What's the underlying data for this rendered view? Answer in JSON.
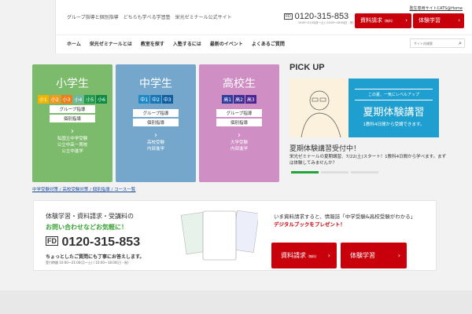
{
  "header": {
    "tagline": "グループ指導と個別指導　どちらも学べる学習塾　栄光ゼミナール公式サイト",
    "phone_icon": "フリーダイヤル",
    "phone": "0120-315-853",
    "phone_hours": "10:00～21:00(月～土) / 10:00～18:00(日・祝)",
    "cats_link": "塾生専用サイトCATS@Home",
    "request_btn": "資料請求",
    "request_small": "（無料）",
    "trial_btn": "体験学習",
    "arrow": "›"
  },
  "nav": {
    "items": [
      "ホーム",
      "栄光ゼミナールとは",
      "教室を探す",
      "入塾するには",
      "最新のイベント",
      "よくあるご質問"
    ],
    "search_placeholder": "サイト内検索"
  },
  "cards": [
    {
      "title": "小学生",
      "grades": [
        "小1",
        "小2",
        "小3",
        "小4",
        "小5",
        "小6"
      ],
      "pills": [
        "グループ指導",
        "個別指導"
      ],
      "sub": [
        "私国立中学受験",
        "公立中高一貫校",
        "公立中進学"
      ]
    },
    {
      "title": "中学生",
      "grades": [
        "中1",
        "中2",
        "中3"
      ],
      "pills": [
        "グループ指導",
        "個別指導"
      ],
      "sub": [
        "高校受験",
        "内部進学"
      ]
    },
    {
      "title": "高校生",
      "grades": [
        "高1",
        "高2",
        "高3"
      ],
      "pills": [
        "グループ指導",
        "個別指導"
      ],
      "sub": [
        "大学受験",
        "内部進学"
      ]
    }
  ],
  "links": "中学受験対策 / 高校受験対策 / 個別指導 / コース一覧",
  "pickup": {
    "heading": "PICK UP",
    "banner_top": "この夏、一気にレベルアップ",
    "banner_title": "夏期体験講習",
    "banner_sub": "1教科4日間から受講できます。",
    "title": "夏期体験講習受付中！",
    "desc": "栄光ゼミナールの夏期講習、7/22(土)スタート！1教科4日間から学べます。まずは体験してみませんか？",
    "slide_active": 1,
    "slide_count": 3
  },
  "contact": {
    "line1": "体験学習・資料請求・受講料の",
    "line2": "お問い合わせなどお気軽に！",
    "phone": "0120-315-853",
    "note": "ちょっとしたご質問にも丁寧にお答えします。",
    "hours": "受付時間 10:00～21:00(月～土) / 10:00～18:00(日・祝)",
    "promo1": "いま資料請求すると、情報誌「中学受験&高校受験がわかる」",
    "promo2": "デジタルブックをプレゼント！",
    "request_btn": "資料請求",
    "request_small": "（無料）",
    "trial_btn": "体験学習"
  }
}
